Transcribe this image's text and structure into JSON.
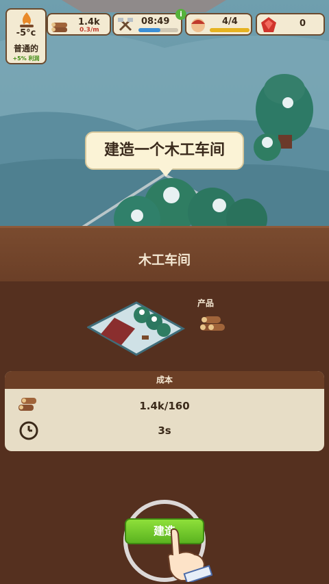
{
  "hud": {
    "temperature": "-5°c",
    "weather_label": "普通的",
    "weather_bonus": "+5% 利润",
    "wood": "1.4k",
    "wood_rate": "0.3/m",
    "timer": "08:49",
    "timer_progress": 0.55,
    "workers": "4/4",
    "workers_progress": 1.0,
    "gems": "0",
    "info_badge": "i"
  },
  "tutorial": {
    "bubble_text": "建造一个木工车间"
  },
  "panel": {
    "title": "木工车间",
    "product_label": "产品",
    "cost_header": "成本",
    "cost_wood": "1.4k/160",
    "cost_time": "3s",
    "build_label": "建造"
  }
}
